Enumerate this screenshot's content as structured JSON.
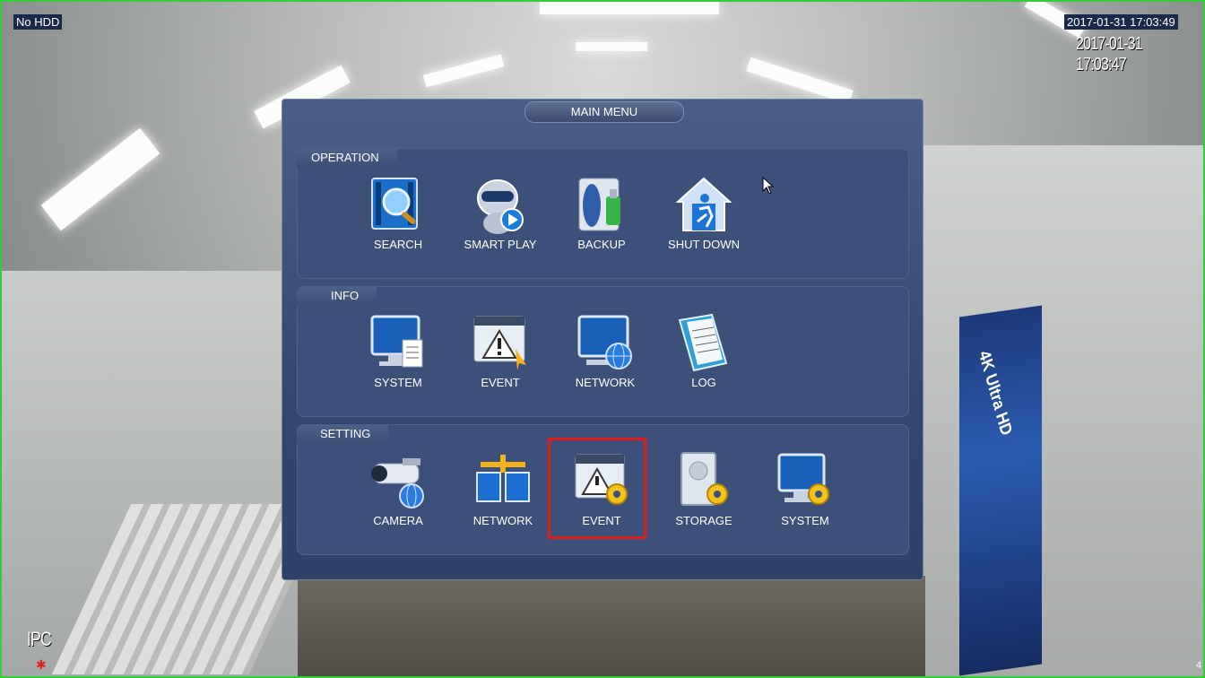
{
  "osd": {
    "hdd_status": "No HDD",
    "datetime_box": "2017-01-31 17:03:49",
    "datetime_camera": "2017-01-31 17:03:47",
    "channel_label": "IPC",
    "channel_number": "4"
  },
  "menu": {
    "title": "MAIN MENU",
    "groups": [
      {
        "label": "OPERATION",
        "items": [
          {
            "label": "SEARCH",
            "icon": "search-icon"
          },
          {
            "label": "SMART PLAY",
            "icon": "smart-play-icon"
          },
          {
            "label": "BACKUP",
            "icon": "backup-icon"
          },
          {
            "label": "SHUT DOWN",
            "icon": "shut-down-icon"
          }
        ]
      },
      {
        "label": "INFO",
        "items": [
          {
            "label": "SYSTEM",
            "icon": "system-info-icon"
          },
          {
            "label": "EVENT",
            "icon": "event-info-icon"
          },
          {
            "label": "NETWORK",
            "icon": "network-info-icon"
          },
          {
            "label": "LOG",
            "icon": "log-icon"
          }
        ]
      },
      {
        "label": "SETTING",
        "items": [
          {
            "label": "CAMERA",
            "icon": "camera-icon"
          },
          {
            "label": "NETWORK",
            "icon": "network-setting-icon"
          },
          {
            "label": "EVENT",
            "icon": "event-setting-icon"
          },
          {
            "label": "STORAGE",
            "icon": "storage-icon"
          },
          {
            "label": "SYSTEM",
            "icon": "system-setting-icon"
          }
        ]
      }
    ]
  },
  "banner_text": "4K Ultra HD",
  "colors": {
    "highlight": "#e21a1a",
    "border": "#2fcf3a",
    "menu_bg": "#34476d"
  }
}
